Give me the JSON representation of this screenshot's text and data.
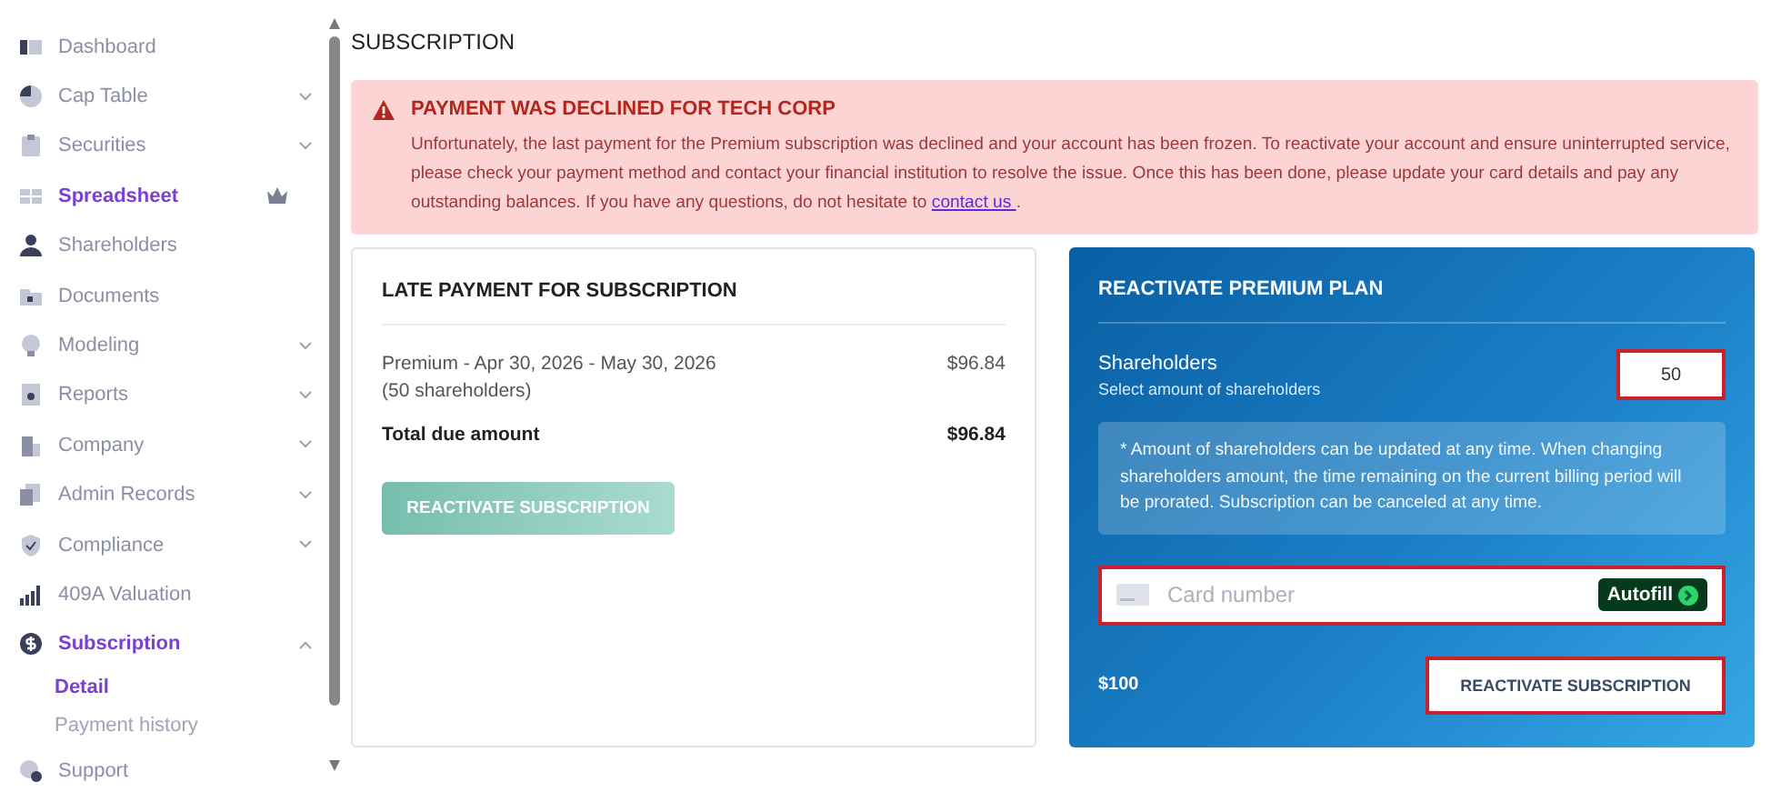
{
  "sidebar": {
    "items": [
      {
        "label": "Dashboard",
        "selected": false,
        "expandable": false,
        "expanded": false,
        "premium": false
      },
      {
        "label": "Cap Table",
        "selected": false,
        "expandable": true,
        "expanded": false,
        "premium": false
      },
      {
        "label": "Securities",
        "selected": false,
        "expandable": true,
        "expanded": false,
        "premium": false
      },
      {
        "label": "Spreadsheet",
        "selected": true,
        "expandable": false,
        "expanded": false,
        "premium": true
      },
      {
        "label": "Shareholders",
        "selected": false,
        "expandable": false,
        "expanded": false,
        "premium": false
      },
      {
        "label": "Documents",
        "selected": false,
        "expandable": false,
        "expanded": false,
        "premium": false
      },
      {
        "label": "Modeling",
        "selected": false,
        "expandable": true,
        "expanded": false,
        "premium": false
      },
      {
        "label": "Reports",
        "selected": false,
        "expandable": true,
        "expanded": false,
        "premium": false
      },
      {
        "label": "Company",
        "selected": false,
        "expandable": true,
        "expanded": false,
        "premium": false
      },
      {
        "label": "Admin Records",
        "selected": false,
        "expandable": true,
        "expanded": false,
        "premium": false
      },
      {
        "label": "Compliance",
        "selected": false,
        "expandable": true,
        "expanded": false,
        "premium": false
      },
      {
        "label": "409A Valuation",
        "selected": false,
        "expandable": false,
        "expanded": false,
        "premium": false
      },
      {
        "label": "Subscription",
        "selected": true,
        "expandable": true,
        "expanded": true,
        "premium": false,
        "children": [
          {
            "label": "Detail",
            "selected": true
          },
          {
            "label": "Payment history",
            "selected": false
          }
        ]
      },
      {
        "label": "Support",
        "selected": false,
        "expandable": false,
        "expanded": false,
        "premium": false
      }
    ]
  },
  "page_title": "SUBSCRIPTION",
  "alert": {
    "title": "PAYMENT WAS DECLINED FOR TECH CORP",
    "message": "Unfortunately, the last payment for the Premium subscription was declined and your account has been frozen. To reactivate your account and ensure uninterrupted service, please check your payment method and contact your financial institution to resolve the issue. Once this has been done, please update your card details and pay any outstanding balances. If you have any questions, do not hesitate to",
    "link": "contact us ",
    "after_link": "."
  },
  "late_payment": {
    "title": "LATE PAYMENT FOR SUBSCRIPTION",
    "lines": [
      {
        "description": "Premium - Apr 30, 2026 - May 30, 2026",
        "note": "(50 shareholders)",
        "amount": "$96.84"
      }
    ],
    "total_label": "Total due amount",
    "total_amount": "$96.84",
    "button": {
      "label": "REACTIVATE SUBSCRIPTION",
      "disabled": true
    }
  },
  "reactivate": {
    "title": "REACTIVATE PREMIUM PLAN",
    "shareholders_label": "Shareholders",
    "shareholders_hint": "Select amount of shareholders",
    "shareholders_field": {
      "value": "50",
      "highlighted": true
    },
    "notice": "* Amount of shareholders can be updated at any time. When changing shareholders amount, the time remaining on the current billing period will be prorated. Subscription can be canceled at any time.",
    "card_field": {
      "placeholder": "Card number",
      "highlighted": true,
      "autofill": "Autofill"
    },
    "price": "$100",
    "button": {
      "label": "REACTIVATE SUBSCRIPTION",
      "highlighted": true
    }
  }
}
